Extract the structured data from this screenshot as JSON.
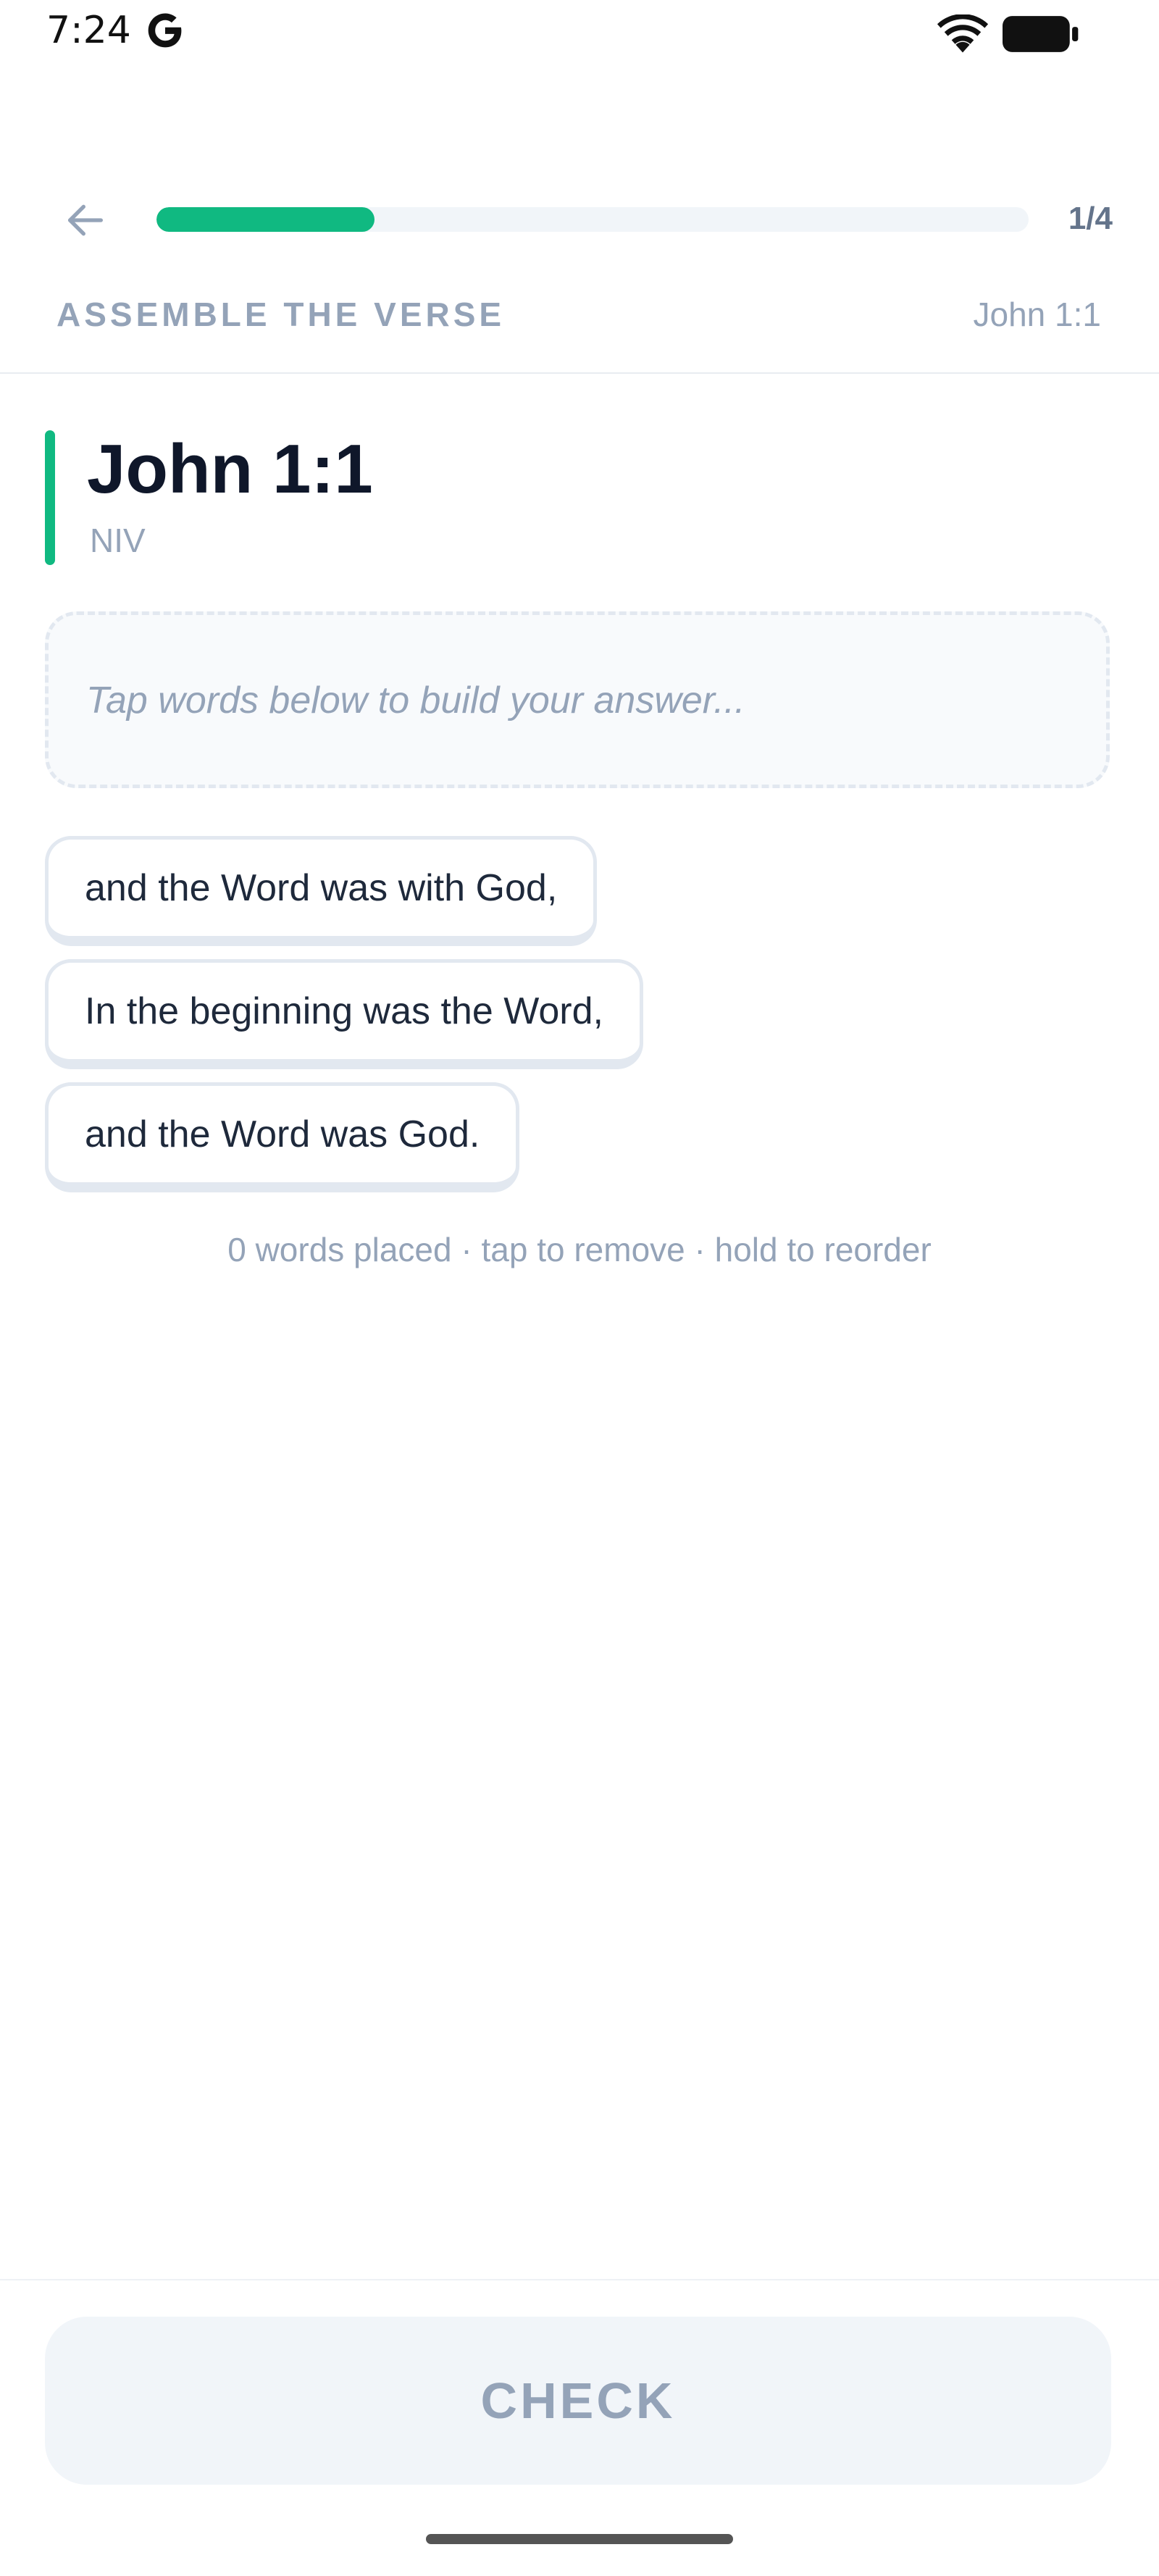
{
  "status_bar": {
    "time": "7:24",
    "icons": [
      "google-g-icon",
      "wifi-icon",
      "battery-icon"
    ]
  },
  "header": {
    "progress_label": "1/4",
    "progress_fraction": 0.25,
    "exercise_label": "ASSEMBLE THE VERSE",
    "reference": "John 1:1"
  },
  "verse": {
    "title": "John 1:1",
    "translation": "NIV"
  },
  "answer": {
    "placeholder": "Tap words below to build your answer..."
  },
  "word_bank": [
    "and the Word was with God,",
    "In the beginning was the Word,",
    "and the Word was God."
  ],
  "hint": "0 words placed · tap to remove · hold to reorder",
  "footer": {
    "check_label": "CHECK"
  },
  "colors": {
    "accent": "#10b981",
    "muted": "#94a3b8",
    "text": "#0f172a",
    "chip_border": "#e2e8f0"
  }
}
